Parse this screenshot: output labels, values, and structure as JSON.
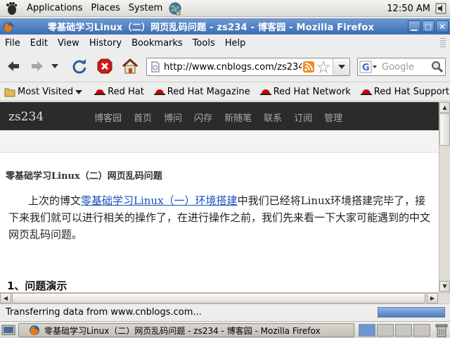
{
  "panel": {
    "applications": "Applications",
    "places": "Places",
    "system": "System",
    "clock": "12:50 AM"
  },
  "window": {
    "title": "零基础学习Linux（二）网页乱码问题 - zs234 - 博客园 - Mozilla Firefox",
    "min": "▁",
    "max": "□",
    "close": "×"
  },
  "menu": {
    "file": "File",
    "edit": "Edit",
    "view": "View",
    "history": "History",
    "bookmarks": "Bookmarks",
    "tools": "Tools",
    "help": "Help"
  },
  "nav": {
    "url": "http://www.cnblogs.com/zs234/",
    "search_placeholder": "Google"
  },
  "bookmarks": {
    "most_visited": "Most Visited",
    "items": [
      "Red Hat",
      "Red Hat Magazine",
      "Red Hat Network",
      "Red Hat Support"
    ]
  },
  "site": {
    "title": "zs234",
    "links": [
      "博客园",
      "首页",
      "博问",
      "闪存",
      "新随笔",
      "联系",
      "订阅",
      "管理"
    ]
  },
  "post": {
    "title": "零基础学习Linux（二）网页乱码问题",
    "body_prefix": "上次的博文",
    "link_text": "零基础学习Linux（一）环境搭建",
    "body_suffix": "中我们已经将Linux环境搭建完毕了，接下来我们就可以进行相关的操作了，在进行操作之前，我们先来看一下大家可能遇到的中文网页乱码问题。",
    "heading": "1、问题演示"
  },
  "status": {
    "text": "Transferring data from www.cnblogs.com...",
    "progress": 1.0
  },
  "taskbar": {
    "task_label": "零基础学习Linux（二）网页乱码问题 - zs234 - 博客园 - Mozilla Firefox",
    "workspaces": 4,
    "active_workspace": 1
  },
  "colors": {
    "titlebar": "#3b6db4",
    "site_nav": "#2b2b2b",
    "link": "#1a4fb8",
    "redhat": "#cc0000"
  },
  "icons": {
    "panel": [
      "gnome-foot-icon",
      "network-globe-icon",
      "volume-icon"
    ],
    "toolbar": [
      "back-arrow-icon",
      "forward-arrow-icon",
      "history-dropdown-icon",
      "reload-icon",
      "stop-icon",
      "home-icon"
    ],
    "url": [
      "page-icon",
      "rss-feed-icon",
      "bookmark-star-icon"
    ],
    "search": [
      "google-icon",
      "magnifier-icon"
    ]
  }
}
